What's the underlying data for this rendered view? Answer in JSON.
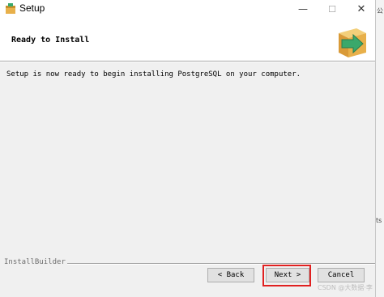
{
  "window": {
    "title": "Setup",
    "minimize_glyph": "—",
    "maximize_glyph": "☐",
    "close_glyph": "✕",
    "icon": "installer-app-icon"
  },
  "header": {
    "title": "Ready to Install",
    "logo_icon": "box-with-arrow-icon"
  },
  "body": {
    "description": "Setup is now ready to begin installing PostgreSQL on your computer."
  },
  "footer": {
    "builder_label": "InstallBuilder",
    "back_label": "< Back",
    "next_label": "Next >",
    "cancel_label": "Cancel"
  },
  "background_window": {
    "top_text": "公",
    "lower_text": "ts"
  },
  "watermark": "CSDN @大数据·李",
  "colors": {
    "highlight": "#e02020",
    "panel": "#f0f0f0",
    "logo_green": "#3aa86b",
    "logo_box": "#e8b04a"
  }
}
